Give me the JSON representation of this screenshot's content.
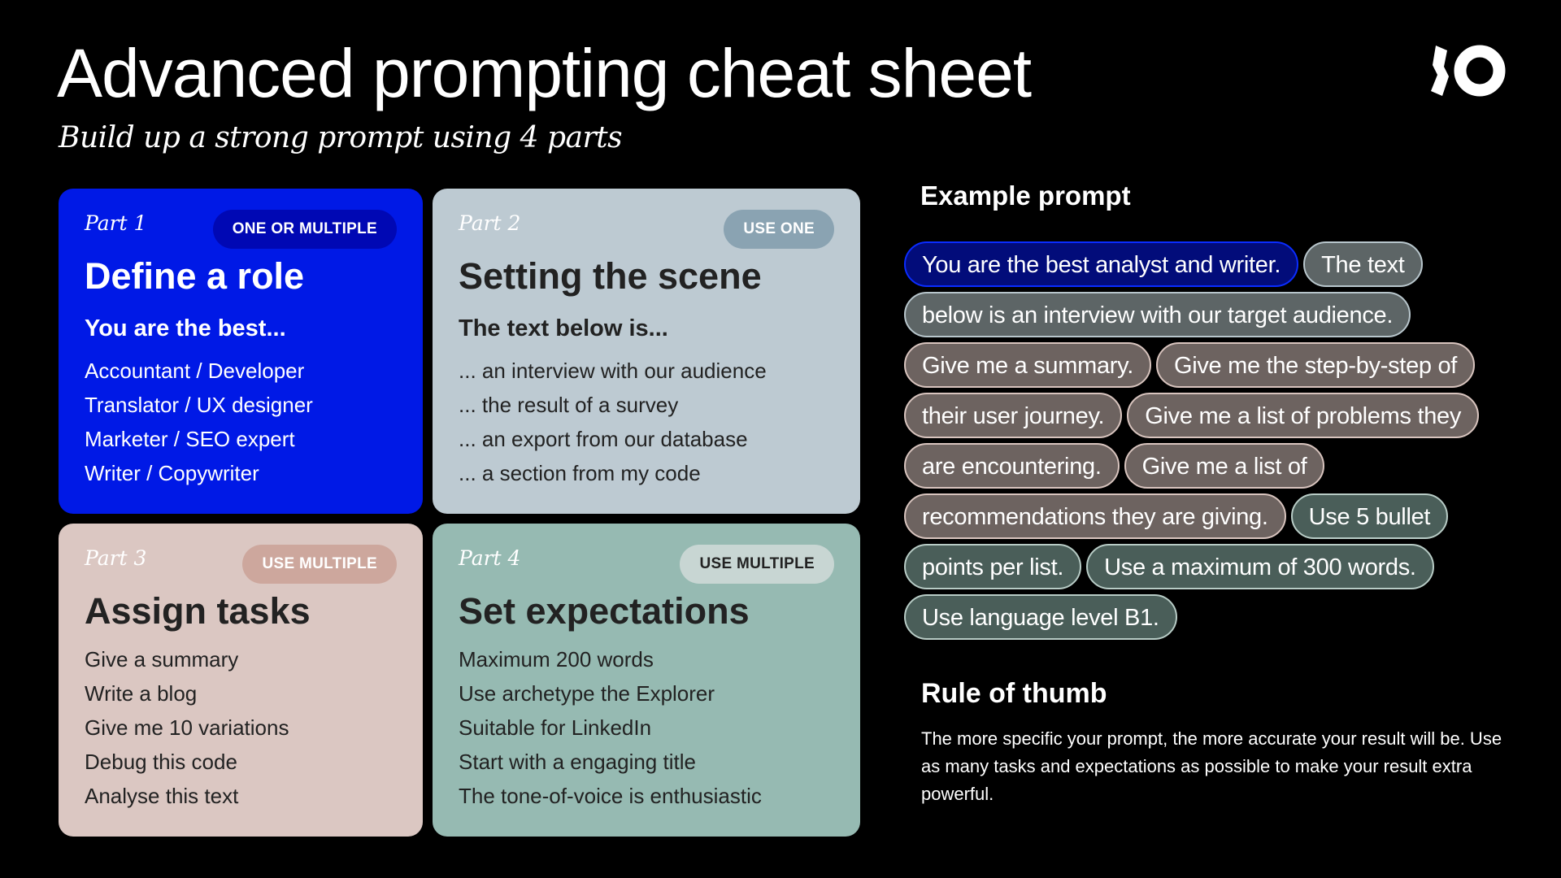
{
  "header": {
    "title": "Advanced prompting cheat sheet",
    "subtitle": "Build up a strong prompt using 4 parts",
    "logo": "io-logo"
  },
  "cards": [
    {
      "part": "Part 1",
      "badge": "ONE OR MULTIPLE",
      "title": "Define a role",
      "lead": "You are the best...",
      "items": [
        "Accountant  /  Developer",
        "Translator  /  UX designer",
        "Marketer  /  SEO expert",
        "Writer  /  Copywriter"
      ],
      "color": "#0019e6"
    },
    {
      "part": "Part 2",
      "badge": "USE ONE",
      "title": "Setting the scene",
      "lead": "The text below is...",
      "items": [
        "... an interview with our audience",
        "... the result of a survey",
        "... an export from our database",
        "... a section from my code"
      ],
      "color": "#bdcad2"
    },
    {
      "part": "Part 3",
      "badge": "USE MULTIPLE",
      "title": "Assign tasks",
      "items": [
        "Give a summary",
        "Write a blog",
        "Give me 10 variations",
        "Debug this code",
        "Analyse this text"
      ],
      "color": "#dbc7c2"
    },
    {
      "part": "Part 4",
      "badge": "USE MULTIPLE",
      "title": "Set expectations",
      "items": [
        "Maximum 200 words",
        "Use archetype the Explorer",
        "Suitable for LinkedIn",
        "Start with a engaging title",
        "The tone-of-voice is enthusiastic"
      ],
      "color": "#96bab2"
    }
  ],
  "example": {
    "heading": "Example prompt",
    "rows": [
      [
        {
          "text": "You are the best analyst and writer.",
          "type": "role"
        },
        {
          "text": "The text",
          "type": "scene"
        }
      ],
      [
        {
          "text": "below is an interview with our target audience.",
          "type": "scene"
        }
      ],
      [
        {
          "text": "Give me a summary.",
          "type": "task"
        },
        {
          "text": "Give me the step-by-step of",
          "type": "task"
        }
      ],
      [
        {
          "text": "their user journey.",
          "type": "task"
        },
        {
          "text": "Give me a list of problems they",
          "type": "task"
        }
      ],
      [
        {
          "text": "are encountering.",
          "type": "task"
        },
        {
          "text": "Give me a list of",
          "type": "task"
        }
      ],
      [
        {
          "text": "recommendations they are giving.",
          "type": "task"
        },
        {
          "text": "Use 5 bullet",
          "type": "expect"
        }
      ],
      [
        {
          "text": "points per list.",
          "type": "expect"
        },
        {
          "text": "Use a maximum of 300 words.",
          "type": "expect"
        }
      ],
      [
        {
          "text": "Use language level B1.",
          "type": "expect"
        }
      ]
    ]
  },
  "rule": {
    "heading": "Rule of thumb",
    "body": "The more specific your prompt, the more accurate your result will be. Use as many tasks and expectations as possible to make your result extra powerful."
  }
}
